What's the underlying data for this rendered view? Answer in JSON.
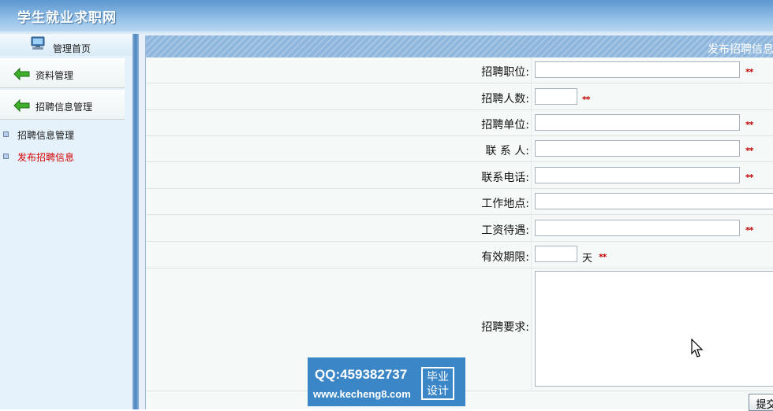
{
  "header": {
    "site_title": "学生就业求职网"
  },
  "sidebar": {
    "home_label": "管理首页",
    "categories": [
      {
        "label": "资料管理"
      },
      {
        "label": "招聘信息管理"
      }
    ],
    "links": [
      {
        "label": "招聘信息管理",
        "active": false
      },
      {
        "label": "发布招聘信息",
        "active": true
      }
    ]
  },
  "main": {
    "panel_title": "发布招聘信息",
    "fields": {
      "position": {
        "label": "招聘职位:",
        "value": "",
        "required_mark": "**"
      },
      "headcount": {
        "label": "招聘人数:",
        "value": "",
        "required_mark": "**"
      },
      "company": {
        "label": "招聘单位:",
        "value": "",
        "required_mark": "**"
      },
      "contact": {
        "label": "联 系 人:",
        "value": "",
        "required_mark": "**"
      },
      "phone": {
        "label": "联系电话:",
        "value": "",
        "required_mark": "**"
      },
      "location": {
        "label": "工作地点:",
        "value": ""
      },
      "salary": {
        "label": "工资待遇:",
        "value": "",
        "required_mark": "**"
      },
      "validity": {
        "label": "有效期限:",
        "value": "",
        "unit": "天",
        "required_mark": "**"
      },
      "requirements": {
        "label": "招聘要求:",
        "value": ""
      }
    },
    "submit_label": "提交"
  },
  "watermark": {
    "qq": "QQ:459382737",
    "url": "www.kecheng8.com",
    "badge_line1": "毕业",
    "badge_line2": "设计"
  },
  "colors": {
    "header": "#6fa6d9",
    "accent_red": "#c00000",
    "active_link": "#d40000",
    "panel_head": "#8fb7de",
    "watermark": "#3b86c6"
  }
}
